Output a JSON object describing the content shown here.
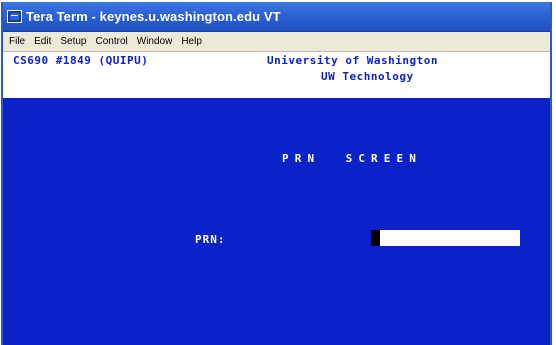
{
  "window": {
    "title": "Tera Term - keynes.u.washington.edu VT",
    "icon": "terminal-icon"
  },
  "menu": {
    "items": [
      {
        "label": "File"
      },
      {
        "label": "Edit"
      },
      {
        "label": "Setup"
      },
      {
        "label": "Control"
      },
      {
        "label": "Window"
      },
      {
        "label": "Help"
      }
    ]
  },
  "header": {
    "session": "CS690 #1849 (QUIPU)",
    "institution": "University of Washington",
    "department": "UW Technology"
  },
  "screen": {
    "title": "PRN  SCREEN",
    "prn_label": "PRN:",
    "prn_value": ""
  },
  "colors": {
    "terminal_background": "#0a22c8",
    "header_text": "#0a22c8",
    "screen_text": "#ffffff",
    "titlebar": "#2d62d6"
  }
}
